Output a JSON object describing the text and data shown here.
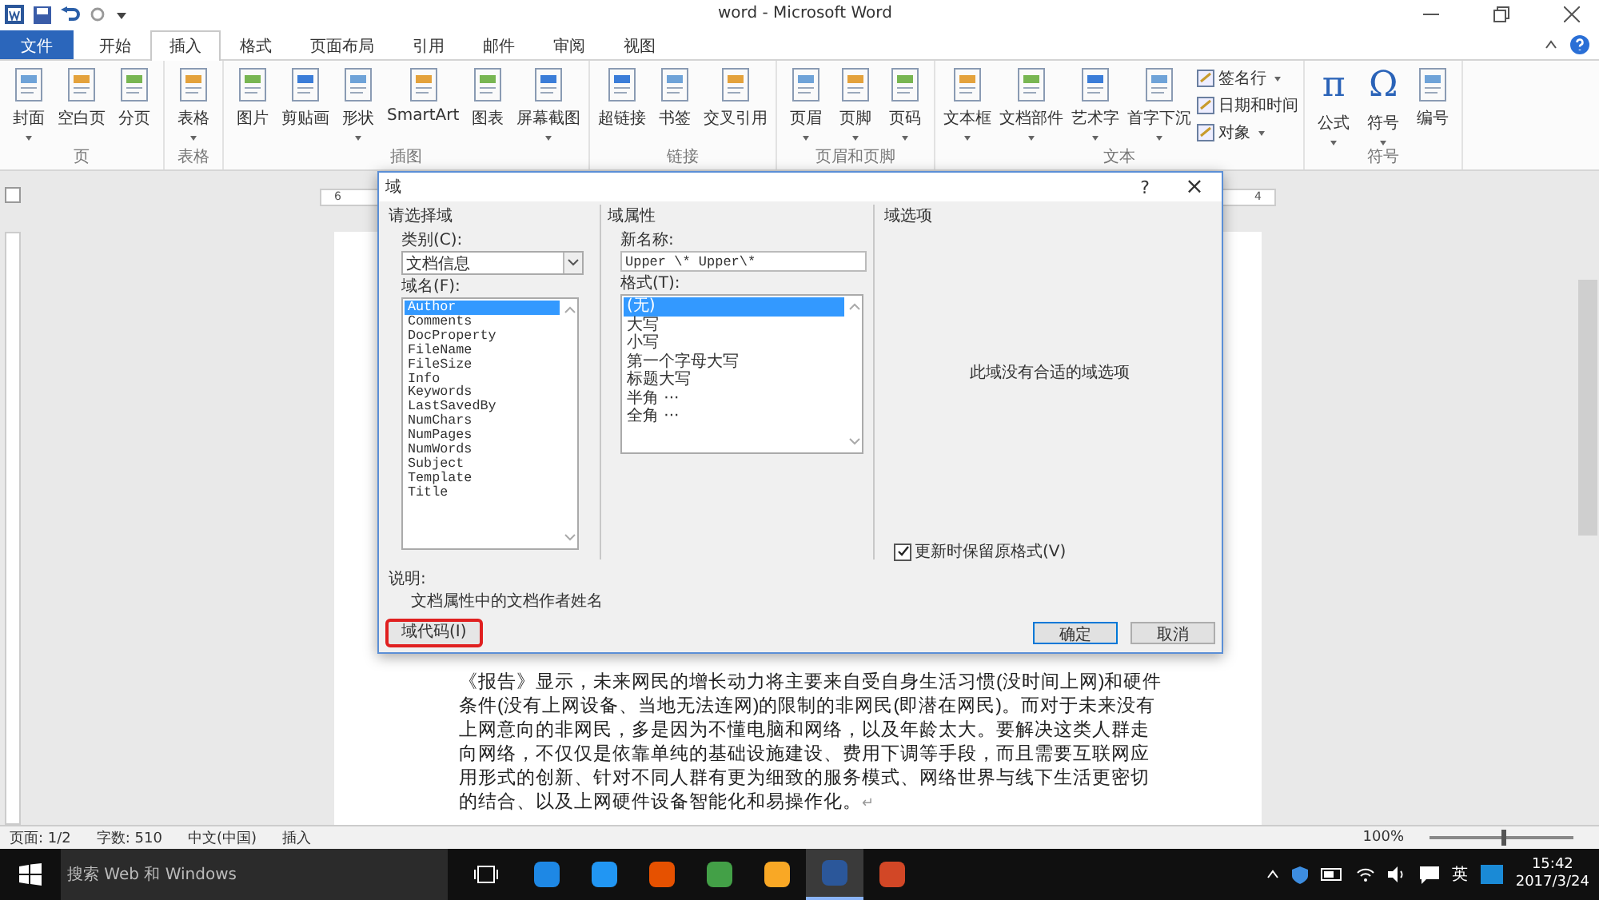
{
  "window": {
    "title": "word - Microsoft Word"
  },
  "tabs": [
    {
      "label": "文件",
      "kind": "file",
      "selected": false
    },
    {
      "label": "开始",
      "kind": "tab",
      "selected": false
    },
    {
      "label": "插入",
      "kind": "tab",
      "selected": true
    },
    {
      "label": "格式",
      "kind": "tab",
      "selected": false
    },
    {
      "label": "页面布局",
      "kind": "tab",
      "selected": false
    },
    {
      "label": "引用",
      "kind": "tab",
      "selected": false
    },
    {
      "label": "邮件",
      "kind": "tab",
      "selected": false
    },
    {
      "label": "审阅",
      "kind": "tab",
      "selected": false
    },
    {
      "label": "视图",
      "kind": "tab",
      "selected": false
    }
  ],
  "ribbon": {
    "groups": [
      {
        "label": "页",
        "buttons": [
          {
            "label": "封面",
            "kind": "large",
            "dropdown": true
          },
          {
            "label": "空白页",
            "kind": "large",
            "dropdown": false
          },
          {
            "label": "分页",
            "kind": "large",
            "dropdown": false
          }
        ]
      },
      {
        "label": "表格",
        "buttons": [
          {
            "label": "表格",
            "kind": "large",
            "dropdown": true
          }
        ]
      },
      {
        "label": "插图",
        "buttons": [
          {
            "label": "图片",
            "kind": "large",
            "dropdown": false
          },
          {
            "label": "剪贴画",
            "kind": "large",
            "dropdown": false
          },
          {
            "label": "形状",
            "kind": "large",
            "dropdown": true
          },
          {
            "label": "SmartArt",
            "kind": "large",
            "dropdown": false
          },
          {
            "label": "图表",
            "kind": "large",
            "dropdown": false
          },
          {
            "label": "屏幕截图",
            "kind": "large",
            "dropdown": true
          }
        ]
      },
      {
        "label": "链接",
        "buttons": [
          {
            "label": "超链接",
            "kind": "large",
            "dropdown": false
          },
          {
            "label": "书签",
            "kind": "large",
            "dropdown": false
          },
          {
            "label": "交叉引用",
            "kind": "large",
            "dropdown": false
          }
        ]
      },
      {
        "label": "页眉和页脚",
        "buttons": [
          {
            "label": "页眉",
            "kind": "large",
            "dropdown": true
          },
          {
            "label": "页脚",
            "kind": "large",
            "dropdown": true
          },
          {
            "label": "页码",
            "kind": "large",
            "dropdown": true
          }
        ]
      },
      {
        "label": "文本",
        "buttons": [
          {
            "label": "文本框",
            "kind": "large",
            "dropdown": true
          },
          {
            "label": "文档部件",
            "kind": "large",
            "dropdown": true
          },
          {
            "label": "艺术字",
            "kind": "large",
            "dropdown": true
          },
          {
            "label": "首字下沉",
            "kind": "large",
            "dropdown": true
          },
          {
            "label": "签名行",
            "kind": "small",
            "dropdown": true
          },
          {
            "label": "日期和时间",
            "kind": "small",
            "dropdown": false
          },
          {
            "label": "对象",
            "kind": "small",
            "dropdown": true
          }
        ]
      },
      {
        "label": "符号",
        "buttons": [
          {
            "label": "公式",
            "kind": "large",
            "glyph": "π",
            "dropdown": true
          },
          {
            "label": "符号",
            "kind": "large",
            "glyph": "Ω",
            "dropdown": true
          },
          {
            "label": "编号",
            "kind": "large",
            "dropdown": false
          }
        ]
      }
    ]
  },
  "ruler": {
    "marks": [
      "6",
      "4"
    ]
  },
  "document": {
    "paragraph": "《报告》显示，未来网民的增长动力将主要来自受自身生活习惯(没时间上网)和硬件条件(没有上网设备、当地无法连网)的限制的非网民(即潜在网民)。而对于未来没有上网意向的非网民，多是因为不懂电脑和网络，以及年龄太大。要解决这类人群走向网络，不仅仅是依靠单纯的基础设施建设、费用下调等手段，而且需要互联网应用形式的创新、针对不同人群有更为细致的服务模式、网络世界与线下生活更密切的结合、以及上网硬件设备智能化和易操作化。",
    "end_mark": "↵"
  },
  "dialog": {
    "title": "域",
    "help": "?",
    "close": "×",
    "choose_section": {
      "heading": "请选择域",
      "category_label": "类别(C):",
      "category_value": "文档信息",
      "names_label": "域名(F):",
      "names": [
        {
          "label": "Author",
          "selected": true
        },
        {
          "label": "Comments",
          "selected": false
        },
        {
          "label": "DocProperty",
          "selected": false
        },
        {
          "label": "FileName",
          "selected": false
        },
        {
          "label": "FileSize",
          "selected": false
        },
        {
          "label": "Info",
          "selected": false
        },
        {
          "label": "Keywords",
          "selected": false
        },
        {
          "label": "LastSavedBy",
          "selected": false
        },
        {
          "label": "NumChars",
          "selected": false
        },
        {
          "label": "NumPages",
          "selected": false
        },
        {
          "label": "NumWords",
          "selected": false
        },
        {
          "label": "Subject",
          "selected": false
        },
        {
          "label": "Template",
          "selected": false
        },
        {
          "label": "Title",
          "selected": false
        }
      ]
    },
    "properties_section": {
      "heading": "域属性",
      "new_name_label": "新名称:",
      "new_name_value": "Upper \\* Upper\\*",
      "format_label": "格式(T):",
      "formats": [
        {
          "label": "(无)",
          "selected": true
        },
        {
          "label": "大写",
          "selected": false
        },
        {
          "label": "小写",
          "selected": false
        },
        {
          "label": "第一个字母大写",
          "selected": false
        },
        {
          "label": "标题大写",
          "selected": false
        },
        {
          "label": "半角 ···",
          "selected": false
        },
        {
          "label": "全角 ···",
          "selected": false
        }
      ]
    },
    "options_section": {
      "heading": "域选项",
      "message": "此域没有合适的域选项",
      "keep_format": {
        "label": "更新时保留原格式(V)",
        "checked": true
      }
    },
    "description_label": "说明:",
    "description": "文档属性中的文档作者姓名",
    "buttons": [
      {
        "label": "域代码(I)",
        "kind": "field-codes",
        "highlighted": true
      },
      {
        "label": "确定",
        "kind": "ok",
        "highlighted": false
      },
      {
        "label": "取消",
        "kind": "cancel",
        "highlighted": false
      }
    ]
  },
  "status_bar": {
    "items": [
      "页面: 1/2",
      "字数: 510",
      "中文(中国)",
      "插入"
    ],
    "zoom": "100%",
    "zoom_slider": {
      "level": 0.5
    }
  },
  "taskbar": {
    "search_placeholder": "搜索 Web 和 Windows",
    "apps": [
      {
        "color": "#1e88e5",
        "selected": false
      },
      {
        "color": "#2196f3",
        "selected": false
      },
      {
        "color": "#e65100",
        "selected": false
      },
      {
        "color": "#43a047",
        "selected": false
      },
      {
        "color": "#f9a825",
        "selected": false
      },
      {
        "color": "#2b579a",
        "selected": true
      },
      {
        "color": "#d24726",
        "selected": false
      }
    ],
    "ime": "英",
    "time": "15:42",
    "date": "2017/3/24"
  }
}
